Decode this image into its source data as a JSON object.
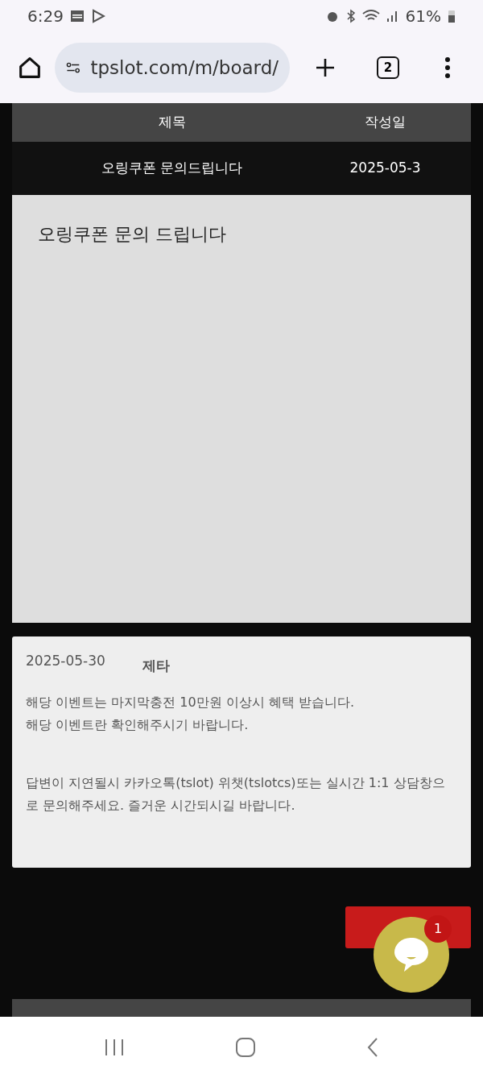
{
  "status_bar": {
    "time": "6:29",
    "battery": "61%"
  },
  "browser": {
    "url": "tpslot.com/m/board/",
    "tab_count": "2"
  },
  "table": {
    "columns": [
      "제목",
      "작성일"
    ],
    "rows": [
      {
        "title": "오링쿠폰 문의드립니다",
        "date": "2025-05-3"
      }
    ]
  },
  "post": {
    "body": "오링쿠폰 문의 드립니다"
  },
  "answer": {
    "date": "2025-05-30",
    "category": "제타",
    "paragraphs": [
      "해당 이벤트는 마지막충전 10만원 이상시 혜택 받습니다.\n해당 이벤트란 확인해주시기 바랍니다.",
      "답변이 지연될시 카카오톡(tslot) 위챗(tslotcs)또는 실시간 1:1 상담창으로 문의해주세요. 즐거운 시간되시길 바랍니다."
    ]
  },
  "chat": {
    "badge": "1"
  }
}
